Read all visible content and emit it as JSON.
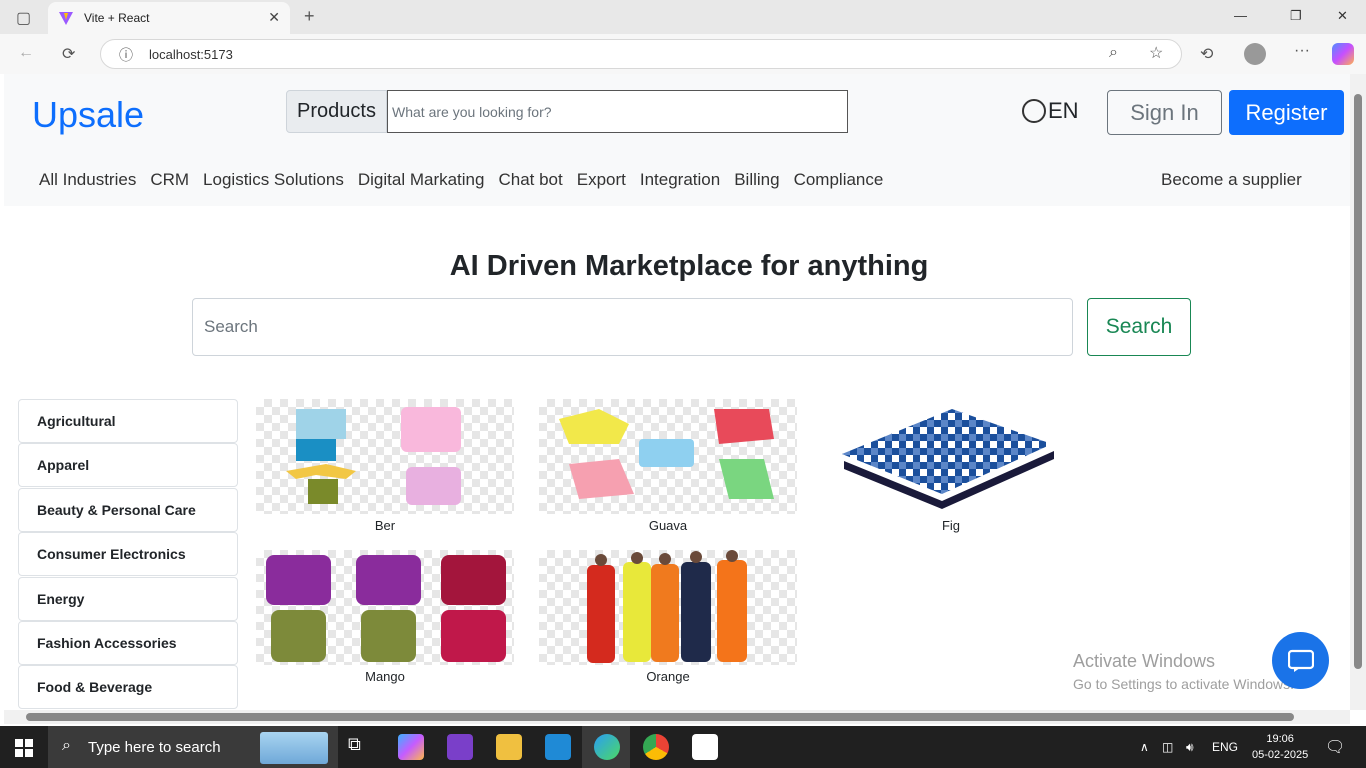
{
  "browser": {
    "tab_title": "Vite + React",
    "url": "localhost:5173"
  },
  "header": {
    "brand": "Upsale",
    "products_label": "Products",
    "search_placeholder": "What are you looking for?",
    "language": "EN",
    "signin_label": "Sign In",
    "register_label": "Register",
    "nav": [
      "All Industries",
      "CRM",
      "Logistics Solutions",
      "Digital Markating",
      "Chat bot",
      "Export",
      "Integration",
      "Billing",
      "Compliance"
    ],
    "supplier_link": "Become a supplier"
  },
  "hero": {
    "title": "AI Driven Marketplace for anything",
    "search_placeholder": "Search",
    "search_button": "Search"
  },
  "categories": [
    "Agricultural",
    "Apparel",
    "Beauty & Personal Care",
    "Consumer Electronics",
    "Energy",
    "Fashion Accessories",
    "Food & Beverage"
  ],
  "products": [
    {
      "name": "Ber"
    },
    {
      "name": "Guava"
    },
    {
      "name": "Fig"
    },
    {
      "name": "Mango"
    },
    {
      "name": "Orange"
    }
  ],
  "watermark": {
    "line1": "Activate Windows",
    "line2": "Go to Settings to activate Windows."
  },
  "taskbar": {
    "search_text": "Type here to search",
    "language": "ENG",
    "time": "19:06",
    "date": "05-02-2025"
  },
  "colors": {
    "brand": "#0d6efd",
    "search_button": "#198754",
    "chat_button": "#1a73e8"
  }
}
